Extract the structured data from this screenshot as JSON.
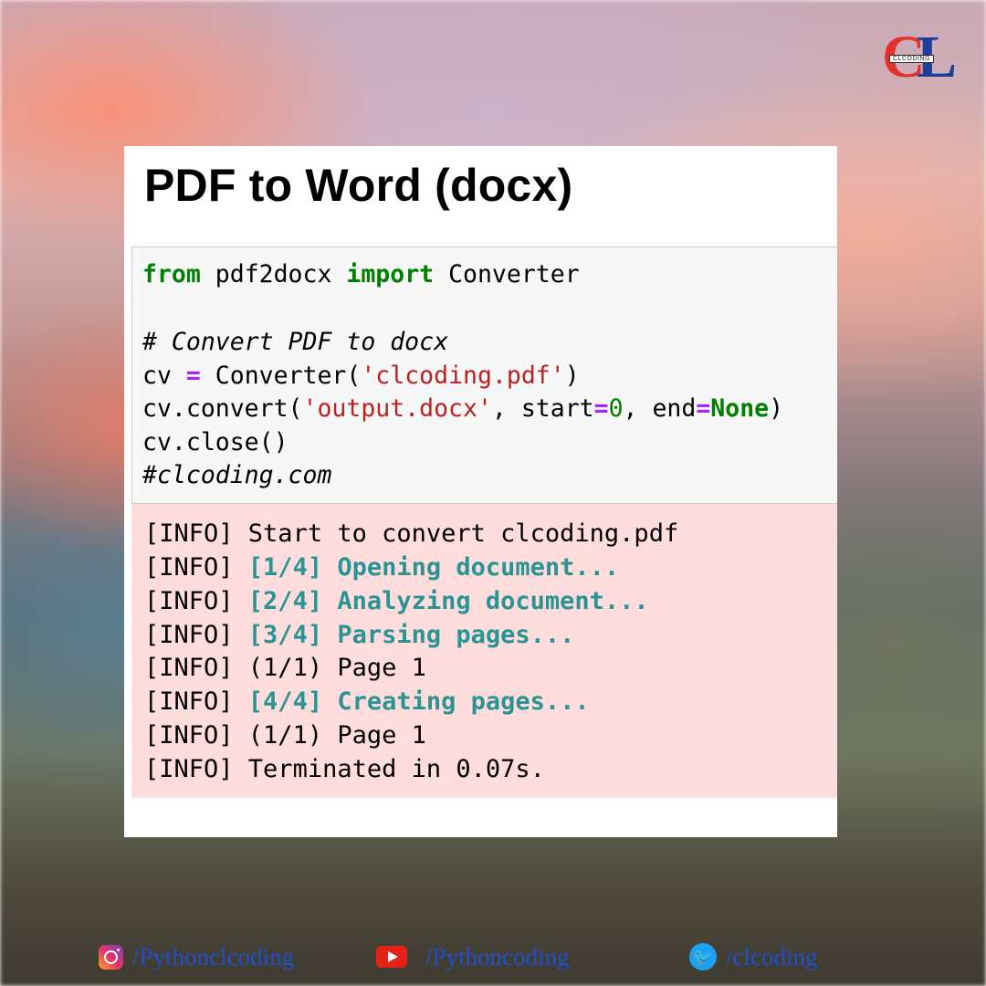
{
  "logo": {
    "brand_text": "CLCODING",
    "letters": {
      "c": "C",
      "l": "L"
    }
  },
  "title": "PDF to Word (docx)",
  "code": {
    "line1": {
      "kw1": "from",
      "mod": " pdf2docx ",
      "kw2": "import",
      "name": " Converter"
    },
    "comment": "# Convert PDF to docx",
    "line3": {
      "a": "cv ",
      "op": "=",
      "b": " Converter(",
      "str": "'clcoding.pdf'",
      "c": ")"
    },
    "line4": {
      "a": "cv.convert(",
      "str": "'output.docx'",
      "b": ", start",
      "op1": "=",
      "num": "0",
      "c": ", end",
      "op2": "=",
      "none": "None",
      "d": ")"
    },
    "line5": "cv.close()",
    "line6": "#clcoding.com"
  },
  "output": [
    {
      "prefix": "[INFO] ",
      "plain": "Start to convert clcoding.pdf",
      "highlight": ""
    },
    {
      "prefix": "[INFO] ",
      "plain": "",
      "highlight": "[1/4] Opening document..."
    },
    {
      "prefix": "[INFO] ",
      "plain": "",
      "highlight": "[2/4] Analyzing document..."
    },
    {
      "prefix": "[INFO] ",
      "plain": "",
      "highlight": "[3/4] Parsing pages..."
    },
    {
      "prefix": "[INFO] ",
      "plain": "(1/1) Page 1",
      "highlight": ""
    },
    {
      "prefix": "[INFO] ",
      "plain": "",
      "highlight": "[4/4] Creating pages..."
    },
    {
      "prefix": "[INFO] ",
      "plain": "(1/1) Page 1",
      "highlight": ""
    },
    {
      "prefix": "[INFO] ",
      "plain": "Terminated in 0.07s.",
      "highlight": ""
    }
  ],
  "social": {
    "instagram": {
      "icon": "instagram-icon",
      "label": "/Pythonclcoding"
    },
    "youtube": {
      "icon": "youtube-icon",
      "label": "/Pythoncoding"
    },
    "twitter": {
      "icon": "twitter-icon",
      "label": "/clcoding"
    }
  },
  "colors": {
    "keyword": "#008000",
    "comment": "#408080",
    "string": "#ba2121",
    "operator": "#aa22ff",
    "output_bg": "#ffdddd",
    "output_highlight": "#2a9494",
    "social_text": "#1f4fd1"
  }
}
